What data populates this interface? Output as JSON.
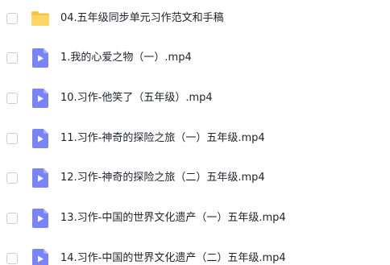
{
  "file_list": {
    "items": [
      {
        "type": "folder",
        "icon": "folder-icon",
        "label": "04.五年级同步单元习作范文和手稿"
      },
      {
        "type": "video",
        "icon": "video-file-icon",
        "label": "1.我的心爱之物（一）.mp4"
      },
      {
        "type": "video",
        "icon": "video-file-icon",
        "label": "10.习作-他笑了（五年级）.mp4"
      },
      {
        "type": "video",
        "icon": "video-file-icon",
        "label": "11.习作-神奇的探险之旅（一）五年级.mp4"
      },
      {
        "type": "video",
        "icon": "video-file-icon",
        "label": "12.习作-神奇的探险之旅（二）五年级.mp4"
      },
      {
        "type": "video",
        "icon": "video-file-icon",
        "label": "13.习作-中国的世界文化遗产（一）五年级.mp4"
      },
      {
        "type": "video",
        "icon": "video-file-icon",
        "label": "14.习作-中国的世界文化遗产（二）五年级.mp4"
      }
    ]
  },
  "colors": {
    "folder": "#f7c340",
    "video_file": "#7b84f5",
    "checkbox_border": "#c9ced6",
    "text": "#1f2329"
  }
}
